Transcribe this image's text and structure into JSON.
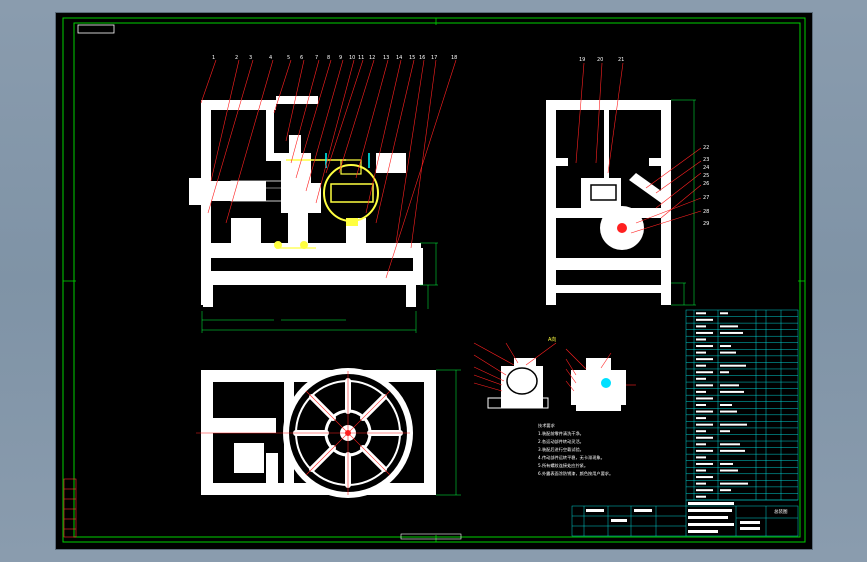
{
  "drawing": {
    "balloons_front": [
      "1",
      "2",
      "3",
      "4",
      "5",
      "6",
      "7",
      "8",
      "9",
      "10",
      "11",
      "12",
      "13",
      "14",
      "15",
      "16",
      "17",
      "18"
    ],
    "balloons_side": [
      "19",
      "20",
      "21"
    ],
    "balloons_side_right": [
      "22",
      "23",
      "24",
      "25",
      "26",
      "27",
      "28",
      "29"
    ],
    "notes_title": "技术要求",
    "notes": [
      "1.装配前零件清洗干净。",
      "2.各运动部件转动灵活。",
      "3.装配后进行空载试验。",
      "4.传动部件运转平稳，无卡滞现象。",
      "5.所有螺纹连接处应拧紧。",
      "6.外露表面涂防锈漆，颜色按用户要求。"
    ],
    "view_label": "A向",
    "title_block_name": "总装图"
  }
}
